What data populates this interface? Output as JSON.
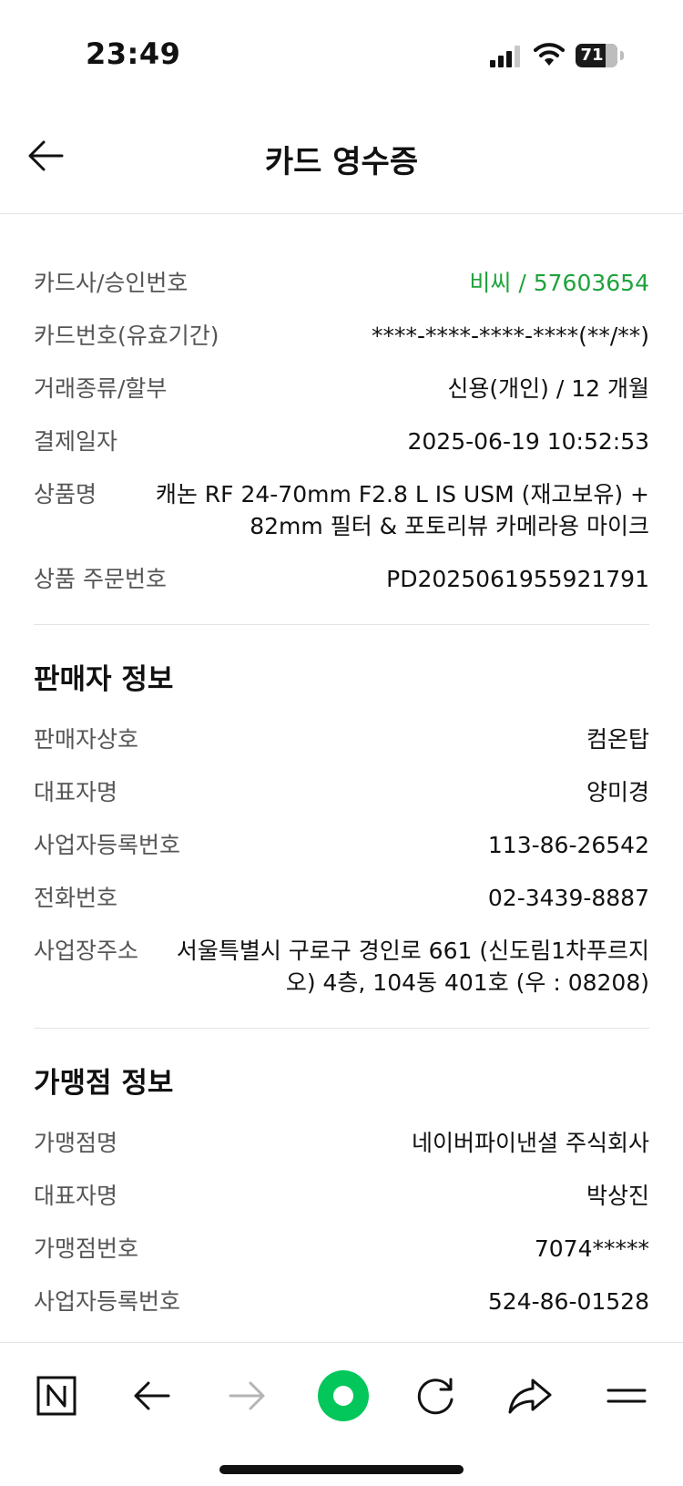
{
  "status": {
    "time": "23:49",
    "battery": "71",
    "battery_level": 0.71
  },
  "header": {
    "title": "카드 영수증"
  },
  "transaction": {
    "rows": [
      {
        "label": "카드사/승인번호",
        "value": "비씨 / 57603654"
      },
      {
        "label": "카드번호(유효기간)",
        "value": "****-****-****-****(**/**)"
      },
      {
        "label": "거래종류/할부",
        "value": "신용(개인) / 12 개월"
      },
      {
        "label": "결제일자",
        "value": "2025-06-19 10:52:53"
      },
      {
        "label": "상품명",
        "value": "캐논 RF 24-70mm F2.8 L IS USM (재고보유) + 82mm 필터 & 포토리뷰 카메라용 마이크"
      },
      {
        "label": "상품 주문번호",
        "value": "PD2025061955921791"
      }
    ]
  },
  "seller": {
    "title": "판매자 정보",
    "rows": [
      {
        "label": "판매자상호",
        "value": "컴온탑"
      },
      {
        "label": "대표자명",
        "value": "양미경"
      },
      {
        "label": "사업자등록번호",
        "value": "113-86-26542"
      },
      {
        "label": "전화번호",
        "value": "02-3439-8887"
      },
      {
        "label": "사업장주소",
        "value": "서울특별시 구로구 경인로 661 (신도림1차푸르지오) 4층, 104동 401호 (우 : 08208)"
      }
    ]
  },
  "merchant": {
    "title": "가맹점 정보",
    "rows": [
      {
        "label": "가맹점명",
        "value": "네이버파이낸셜 주식회사"
      },
      {
        "label": "대표자명",
        "value": "박상진"
      },
      {
        "label": "가맹점번호",
        "value": "7074*****"
      },
      {
        "label": "사업자등록번호",
        "value": "524-86-01528"
      }
    ]
  },
  "colors": {
    "accent": "#1ea33b",
    "brand_green": "#03c75a"
  },
  "bottom_nav": {
    "icons": [
      "naver-n-icon",
      "back-arrow-icon",
      "forward-arrow-icon",
      "home-circle-icon",
      "refresh-icon",
      "share-icon",
      "menu-icon"
    ]
  }
}
